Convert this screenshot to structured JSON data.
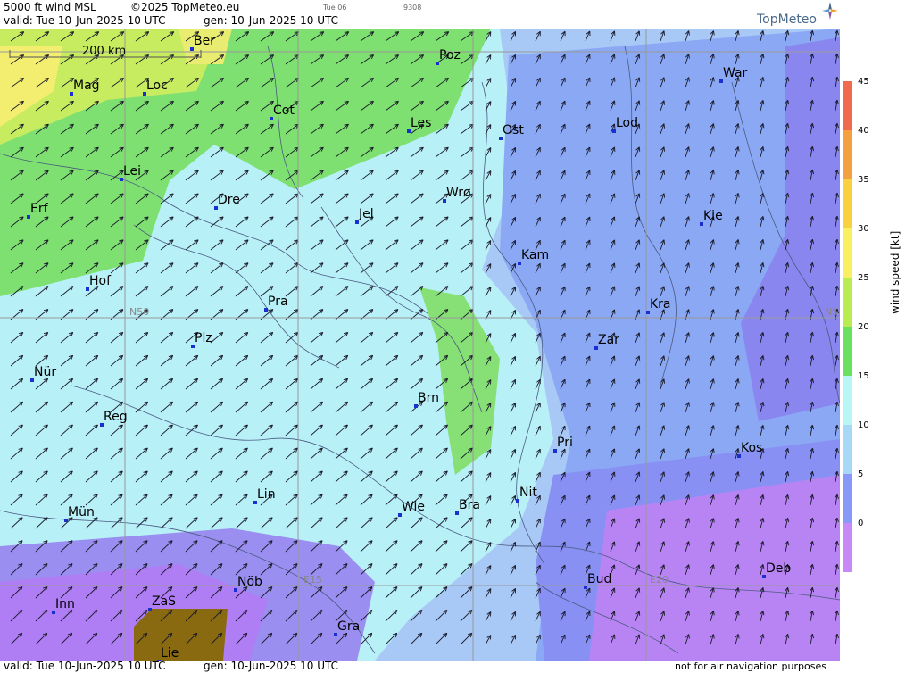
{
  "header": {
    "product": "5000 ft wind MSL",
    "copyright": "©2025 TopMeteo.eu",
    "small_date": "Tue 06",
    "small_code": "9308",
    "valid": "valid:  Tue  10-Jun-2025  10 UTC",
    "gen": "gen: 10-Jun-2025 10 UTC",
    "logo": "TopMeteo"
  },
  "footer": {
    "valid": "valid:  Tue  10-Jun-2025  10 UTC",
    "gen": "gen: 10-Jun-2025 10 UTC",
    "disclaimer": "not for air navigation purposes"
  },
  "scale_bar": "200 km",
  "grid_labels": {
    "n50": "N50",
    "n50_right": "N5",
    "e15": "E15",
    "e20": "E20"
  },
  "legend": {
    "title": "wind speed [kt]",
    "ticks": [
      "45",
      "40",
      "35",
      "30",
      "25",
      "20",
      "15",
      "10",
      "5",
      "0"
    ],
    "colors": [
      "#f06a50",
      "#f5a040",
      "#f8d040",
      "#f8f060",
      "#b8ec50",
      "#6ae060",
      "#b8f6f6",
      "#a8d8f8",
      "#8898f8",
      "#c888f8"
    ]
  },
  "cities": [
    {
      "name": "Ber"
    },
    {
      "name": "Poz"
    },
    {
      "name": "War"
    },
    {
      "name": "Mag"
    },
    {
      "name": "Loc"
    },
    {
      "name": "Cot"
    },
    {
      "name": "Les"
    },
    {
      "name": "Ost"
    },
    {
      "name": "Lod"
    },
    {
      "name": "Lei"
    },
    {
      "name": "Erf"
    },
    {
      "name": "Dre"
    },
    {
      "name": "Wrø"
    },
    {
      "name": "Jel"
    },
    {
      "name": "Kie"
    },
    {
      "name": "Kam"
    },
    {
      "name": "Hof"
    },
    {
      "name": "Pra"
    },
    {
      "name": "Kra"
    },
    {
      "name": "Plz"
    },
    {
      "name": "Zar"
    },
    {
      "name": "Nür"
    },
    {
      "name": "Brn"
    },
    {
      "name": "Reg"
    },
    {
      "name": "Pri"
    },
    {
      "name": "Kos"
    },
    {
      "name": "Lin"
    },
    {
      "name": "Nit"
    },
    {
      "name": "Wie"
    },
    {
      "name": "Bra"
    },
    {
      "name": "Mün"
    },
    {
      "name": "Deb"
    },
    {
      "name": "Nöb"
    },
    {
      "name": "Bud"
    },
    {
      "name": "Inn"
    },
    {
      "name": "ZaS"
    },
    {
      "name": "Gra"
    },
    {
      "name": "Lie"
    }
  ]
}
